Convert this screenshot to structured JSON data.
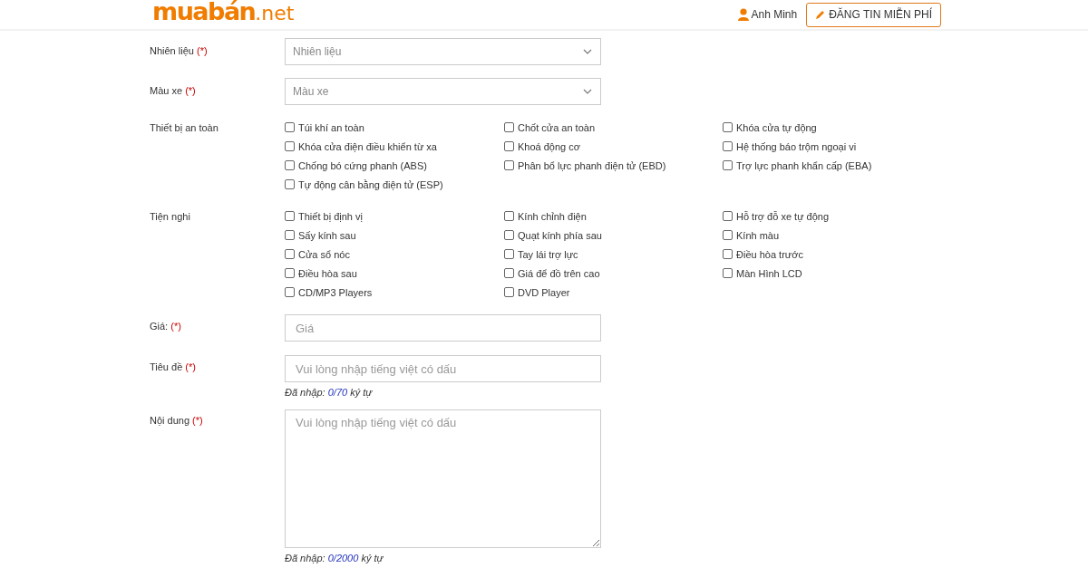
{
  "header": {
    "logo": {
      "name": "muabán",
      "tld": ".net"
    },
    "user": "Anh Minh",
    "post_button": "ĐĂNG TIN MIỄN PHÍ"
  },
  "fields": [
    {
      "kind": "select",
      "label": "Nhiên liệu",
      "required_mark": "(*)",
      "placeholder": "Nhiên liệu"
    },
    {
      "kind": "select",
      "label": "Màu xe",
      "required_mark": "(*)",
      "placeholder": "Màu xe"
    },
    {
      "kind": "checkgroup",
      "label": "Thiết bị an toàn",
      "options": [
        {
          "label": "Túi khí an toàn",
          "checked": false
        },
        {
          "label": "Chốt cửa an toàn",
          "checked": false
        },
        {
          "label": "Khóa cửa tự động",
          "checked": false
        },
        {
          "label": "Khóa cửa điện điều khiển từ xa",
          "checked": false
        },
        {
          "label": "Khoá động cơ",
          "checked": false
        },
        {
          "label": "Hệ thống báo trộm ngoại vi",
          "checked": false
        },
        {
          "label": "Chống bó cứng phanh (ABS)",
          "checked": false
        },
        {
          "label": "Phân bổ lực phanh điện tử (EBD)",
          "checked": false
        },
        {
          "label": "Trợ lực phanh khẩn cấp (EBA)",
          "checked": false
        },
        {
          "label": "Tự động cân bằng điện tử (ESP)",
          "checked": false
        }
      ]
    },
    {
      "kind": "checkgroup",
      "label": "Tiện nghi",
      "options": [
        {
          "label": "Thiết bị định vị",
          "checked": false
        },
        {
          "label": "Kính chỉnh điện",
          "checked": false
        },
        {
          "label": "Hỗ trợ đỗ xe tự động",
          "checked": false
        },
        {
          "label": "Sấy kính sau",
          "checked": false
        },
        {
          "label": "Quạt kính phía sau",
          "checked": false
        },
        {
          "label": "Kính màu",
          "checked": false
        },
        {
          "label": "Cửa sổ nóc",
          "checked": false
        },
        {
          "label": "Tay lái trợ lực",
          "checked": false
        },
        {
          "label": "Điều hòa trước",
          "checked": false
        },
        {
          "label": "Điều hòa sau",
          "checked": false
        },
        {
          "label": "Giá để đồ trên cao",
          "checked": false
        },
        {
          "label": "Màn Hình LCD",
          "checked": false
        },
        {
          "label": "CD/MP3 Players",
          "checked": false
        },
        {
          "label": "DVD Player",
          "checked": false
        }
      ]
    },
    {
      "kind": "input",
      "label": "Giá:",
      "required_mark": "(*)",
      "placeholder": "Giá"
    },
    {
      "kind": "input",
      "label": "Tiêu đề",
      "required_mark": "(*)",
      "placeholder": "Vui lòng nhập tiếng việt có dấu",
      "counter": {
        "prefix": "Đã nhập:",
        "count": "0/70",
        "suffix": "ký tự"
      }
    },
    {
      "kind": "textarea",
      "label": "Nội dung",
      "required_mark": "(*)",
      "placeholder": "Vui lòng nhập tiếng việt có dấu",
      "counter": {
        "prefix": "Đã nhập:",
        "count": "0/2000",
        "suffix": "ký tự"
      }
    }
  ]
}
